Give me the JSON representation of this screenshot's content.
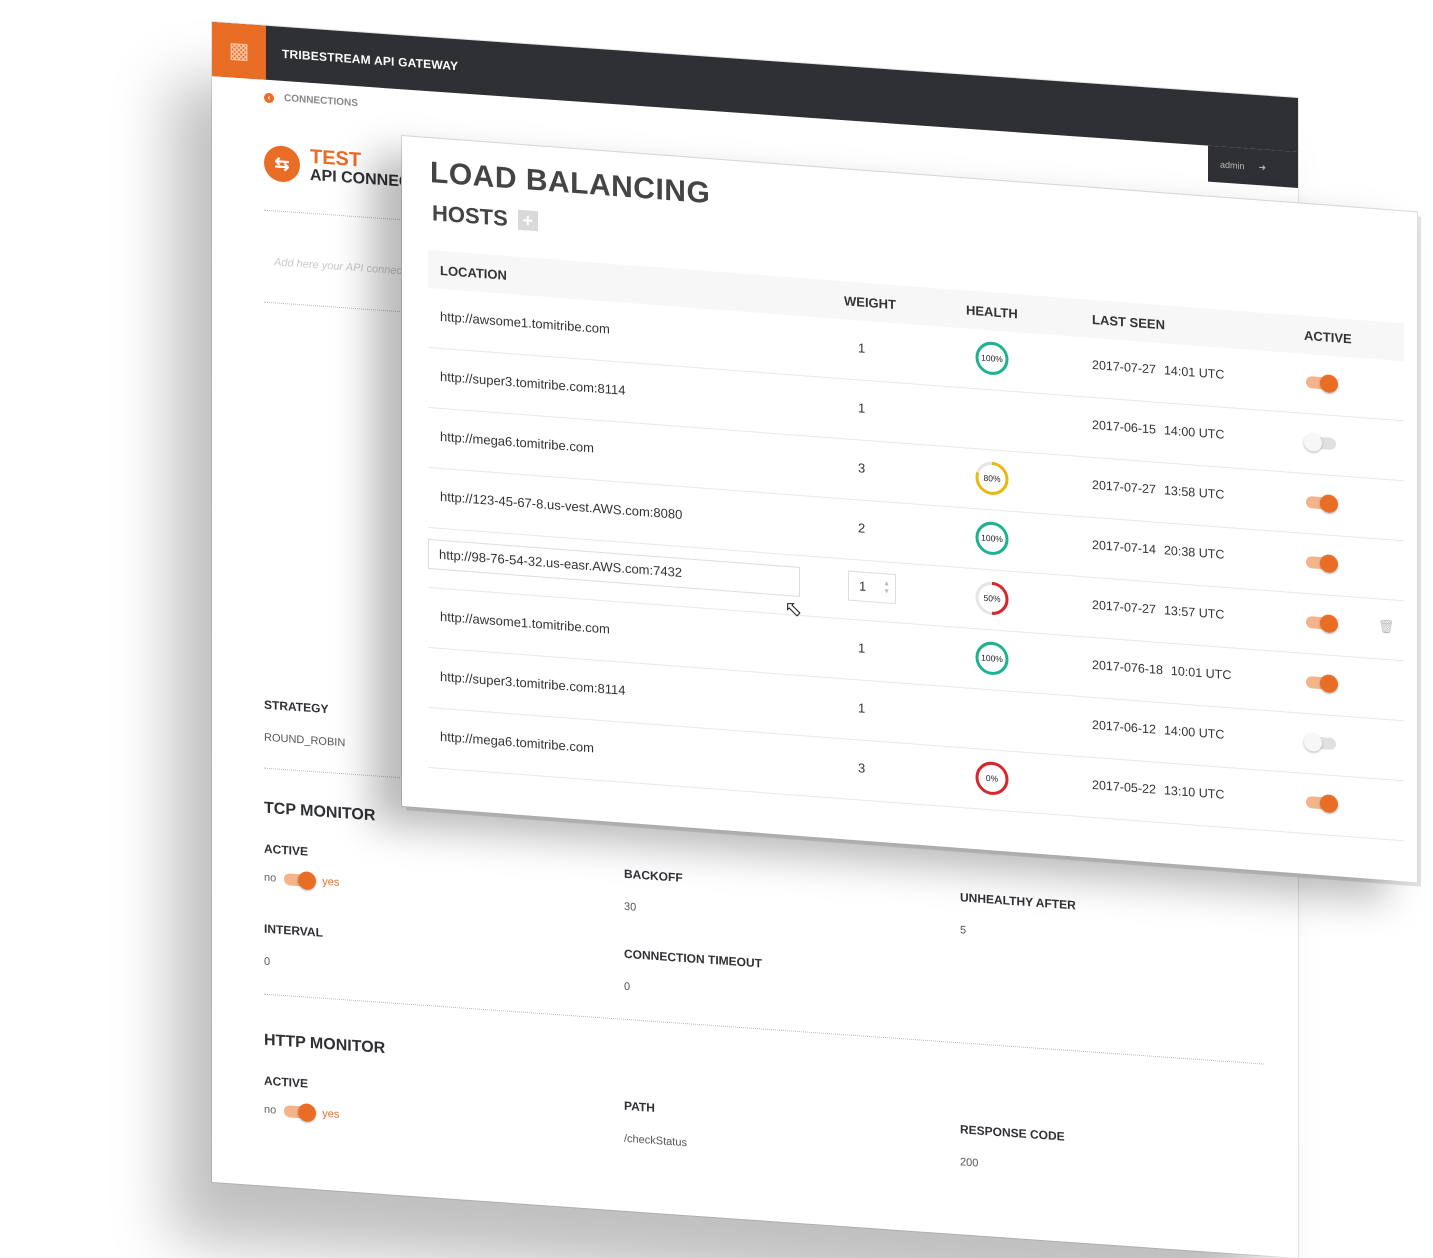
{
  "app": {
    "title": "TRIBESTREAM API GATEWAY",
    "user": "admin",
    "breadcrumb": "CONNECTIONS"
  },
  "connection": {
    "name": "TEST",
    "subtitle": "API CONNEC",
    "description_placeholder": "Add here your API connecti"
  },
  "strategy": {
    "label": "STRATEGY",
    "value": "ROUND_ROBIN"
  },
  "tcp_monitor": {
    "title": "TCP MONITOR",
    "active_label": "ACTIVE",
    "toggle_no": "no",
    "toggle_yes": "yes",
    "backoff_label": "BACKOFF",
    "backoff_value": "30",
    "unhealthy_label": "UNHEALTHY AFTER",
    "unhealthy_value": "5",
    "interval_label": "INTERVAL",
    "interval_value": "0",
    "timeout_label": "CONNECTION TIMEOUT",
    "timeout_value": "0"
  },
  "http_monitor": {
    "title": "HTTP MONITOR",
    "active_label": "ACTIVE",
    "toggle_no": "no",
    "toggle_yes": "yes",
    "path_label": "PATH",
    "path_value": "/checkStatus",
    "code_label": "RESPONSE CODE",
    "code_value": "200"
  },
  "load_balancing": {
    "title": "LOAD BALANCING",
    "hosts_title": "HOSTS",
    "add_label": "+",
    "columns": {
      "location": "LOCATION",
      "weight": "WEIGHT",
      "health": "HEALTH",
      "last_seen": "LAST SEEN",
      "active": "ACTIVE"
    },
    "hosts": [
      {
        "location": "http://awsome1.tomitribe.com",
        "weight": "1",
        "health": "100%",
        "health_value": 100,
        "date": "2017-07-27",
        "time": "14:01 UTC",
        "active": true
      },
      {
        "location": "http://super3.tomitribe.com:8114",
        "weight": "1",
        "health": "",
        "health_value": null,
        "date": "2017-06-15",
        "time": "14:00 UTC",
        "active": false
      },
      {
        "location": "http://mega6.tomitribe.com",
        "weight": "3",
        "health": "80%",
        "health_value": 80,
        "date": "2017-07-27",
        "time": "13:58  UTC",
        "active": true
      },
      {
        "location": "http://123-45-67-8.us-vest.AWS.com:8080",
        "weight": "2",
        "health": "100%",
        "health_value": 100,
        "date": "2017-07-14",
        "time": "20:38  UTC",
        "active": true
      },
      {
        "location": "http://98-76-54-32.us-easr.AWS.com:7432",
        "weight": "1",
        "health": "50%",
        "health_value": 50,
        "date": "2017-07-27",
        "time": "13:57  UTC",
        "active": true
      },
      {
        "location": "http://awsome1.tomitribe.com",
        "weight": "1",
        "health": "100%",
        "health_value": 100,
        "date": "2017-076-18",
        "time": "10:01 UTC",
        "active": true
      },
      {
        "location": "http://super3.tomitribe.com:8114",
        "weight": "1",
        "health": "",
        "health_value": null,
        "date": "2017-06-12",
        "time": "14:00 UTC",
        "active": false
      },
      {
        "location": "http://mega6.tomitribe.com",
        "weight": "3",
        "health": "0%",
        "health_value": 0,
        "date": "2017-05-22",
        "time": "13:10 UTC",
        "active": true
      }
    ]
  },
  "colors": {
    "accent": "#ea6d25",
    "topbar": "#2e3033",
    "health_good": "#1fb28f",
    "health_warn": "#e8b90f",
    "health_bad": "#d8262e"
  }
}
